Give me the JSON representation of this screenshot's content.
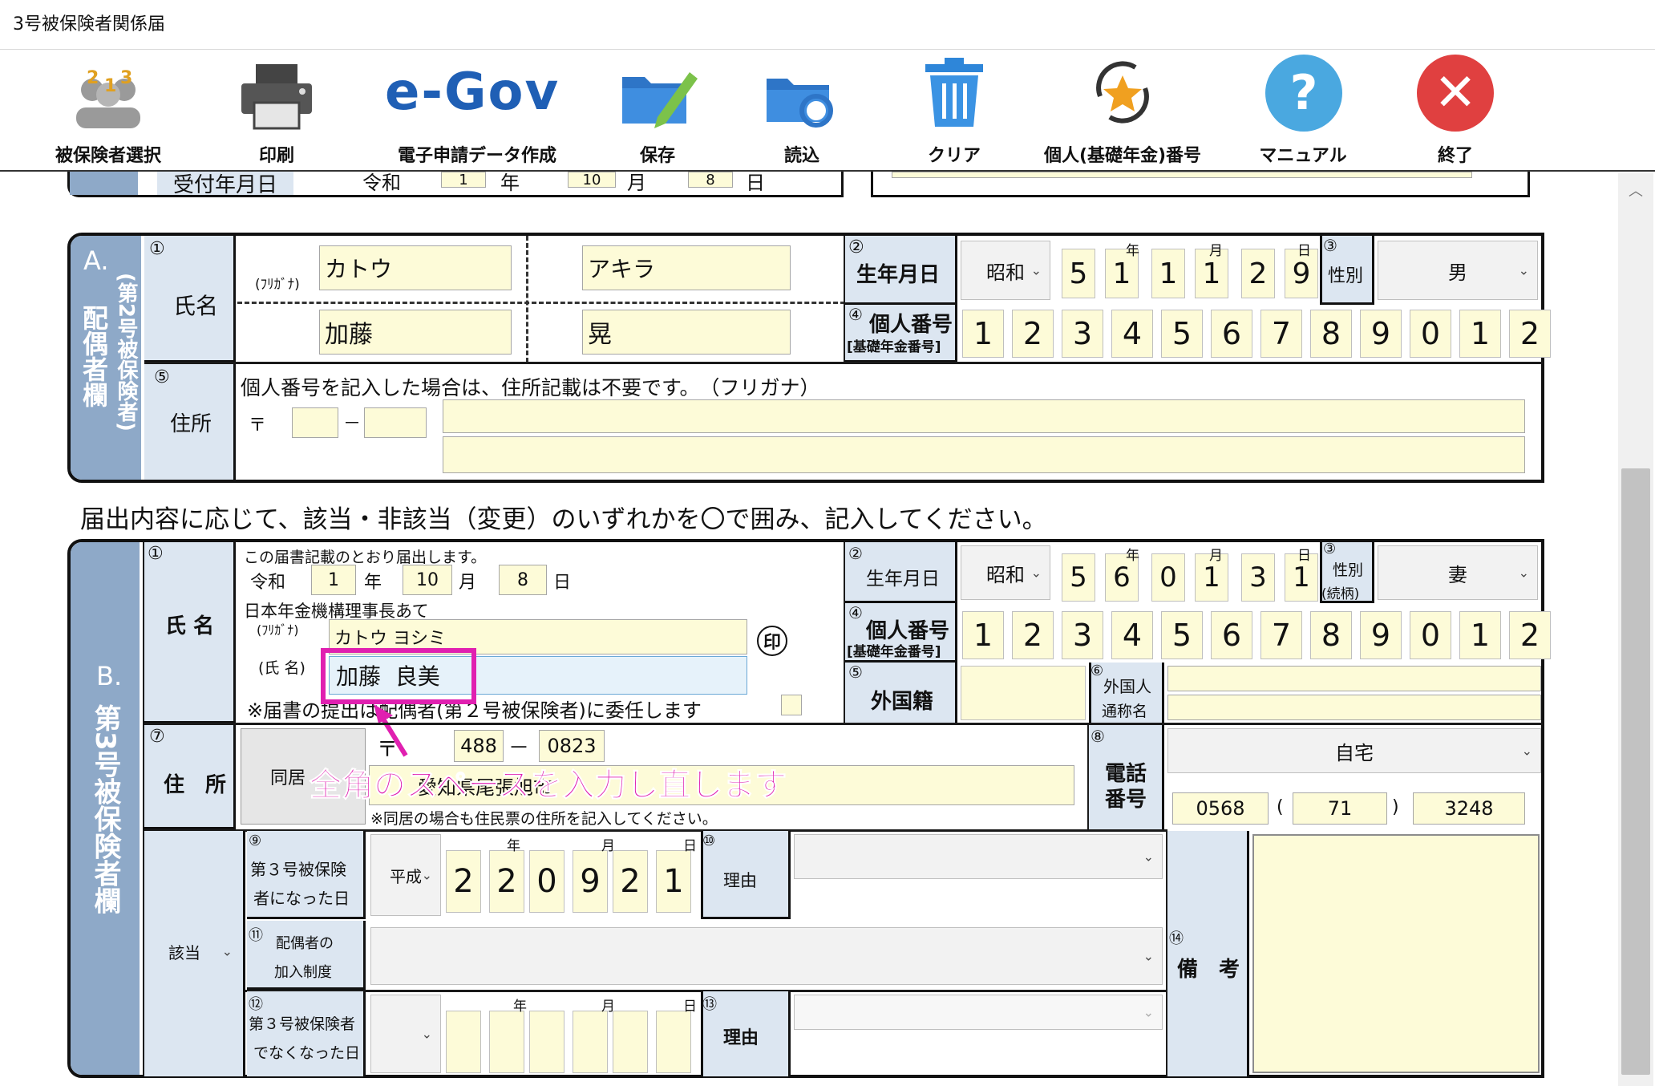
{
  "window": {
    "title": "3号被保険者関係届"
  },
  "toolbar": {
    "select_label": "被保険者選択",
    "print_label": "印刷",
    "egov_logo": "e-Gov",
    "egov_label": "電子申請データ作成",
    "save_label": "保存",
    "load_label": "読込",
    "clear_label": "クリア",
    "number_label": "個人(基礎年金)番号",
    "manual_label": "マニュアル",
    "exit_label": "終了"
  },
  "receipt": {
    "label": "受付年月日",
    "era": "令和",
    "year": "1",
    "year_unit": "年",
    "month": "10",
    "month_unit": "月",
    "day": "8",
    "day_unit": "日"
  },
  "sectionA": {
    "side_title": "A.",
    "side_sub": "(第2号被保険者)",
    "side_main": "配偶者欄",
    "circ1": "①",
    "circ2": "②",
    "circ3": "③",
    "circ4": "④",
    "circ5": "⑤",
    "name_label": "氏名",
    "furigana_tag": "(ﾌﾘｶﾞﾅ)",
    "kana_last": "カトウ",
    "kana_first": "アキラ",
    "name_last": "加藤",
    "name_first": "晃",
    "dob_label": "生年月日",
    "era": "昭和",
    "dob_digits": [
      "5",
      "1",
      "1",
      "1",
      "2",
      "9"
    ],
    "y_unit": "年",
    "m_unit": "月",
    "d_unit": "日",
    "sex_label": "性別",
    "sex_value": "男",
    "num_label1": "個人番号",
    "num_label2": "[基礎年金番号]",
    "num_digits": [
      "1",
      "2",
      "3",
      "4",
      "5",
      "6",
      "7",
      "8",
      "9",
      "0",
      "1",
      "2"
    ],
    "address_label": "住所",
    "address_note": "個人番号を記入した場合は、住所記載は不要です。　（フリガナ）",
    "postal_mark": "〒",
    "postal_dash": "－"
  },
  "instruction": "届出内容に応じて、該当・非該当（変更）のいずれかを〇で囲み、記入してください。",
  "sectionB": {
    "side_title": "B.",
    "side_main": "第3号被保険者欄",
    "circ1": "①",
    "circ2": "②",
    "circ3": "③",
    "circ4": "④",
    "circ5": "⑤",
    "circ6": "⑥",
    "circ7": "⑦",
    "circ8": "⑧",
    "circ9": "⑨",
    "circ10": "⑩",
    "circ11": "⑪",
    "circ12": "⑫",
    "circ13": "⑬",
    "circ14": "⑭",
    "name_label": "氏 名",
    "statement": "この届書記載のとおり届出します。",
    "reiwa": "令和",
    "date_year": "1",
    "date_month": "10",
    "date_day": "8",
    "y_unit": "年",
    "m_unit": "月",
    "d_unit": "日",
    "addressee": "日本年金機構理事長あて",
    "furigana_tag": "(ﾌﾘｶﾞﾅ)",
    "kana_value": "カトウ ヨシミ",
    "name_tag": "(氏 名)",
    "name_value": "加藤  良美",
    "seal": "印",
    "delegate_note": "※届書の提出は配偶者(第２号被保険者)に委任します",
    "dob_label": "生年月日",
    "era": "昭和",
    "dob_digits": [
      "5",
      "6",
      "0",
      "1",
      "3",
      "1"
    ],
    "sex_label1": "性別",
    "sex_label2": "(続柄)",
    "sex_value": "妻",
    "num_label1": "個人番号",
    "num_label2": "[基礎年金番号]",
    "num_digits": [
      "1",
      "2",
      "3",
      "4",
      "5",
      "6",
      "7",
      "8",
      "9",
      "0",
      "1",
      "2"
    ],
    "foreign_label": "外国籍",
    "alias_label1": "外国人",
    "alias_label2": "通称名",
    "address_label": "住　所",
    "cohabit_button": "同居",
    "postal_mark": "〒",
    "postal1": "488",
    "postal_dash": "－",
    "postal2": "0823",
    "address_value": "愛知県尾張旭市",
    "address_note": "※同居の場合も住民票の住所を記入してください。",
    "phone_label1": "電話",
    "phone_label2": "番号",
    "phone_type": "自宅",
    "phone1": "0568",
    "phone_paren_open": "(",
    "phone2": "71",
    "phone_paren_close": ")",
    "phone3": "3248",
    "status_select": "該当",
    "became_label1": "第３号被保険",
    "became_label2": "者になった日",
    "became_era": "平成",
    "became_digits": [
      "2",
      "2",
      "0",
      "9",
      "2",
      "1"
    ],
    "reason_label": "理由",
    "pension_label1": "配偶者の",
    "pension_label2": "加入制度",
    "ceased_label1": "第３号被保険者",
    "ceased_label2": "でなくなった日",
    "remarks_label": "備　考"
  },
  "callout": {
    "text": "全角のスペースを入力し直します",
    "color": "#e020b0"
  },
  "colors": {
    "header_blue": "#dce6f1",
    "side_blue": "#8ea9c8",
    "yellow": "#fdfbd8"
  }
}
